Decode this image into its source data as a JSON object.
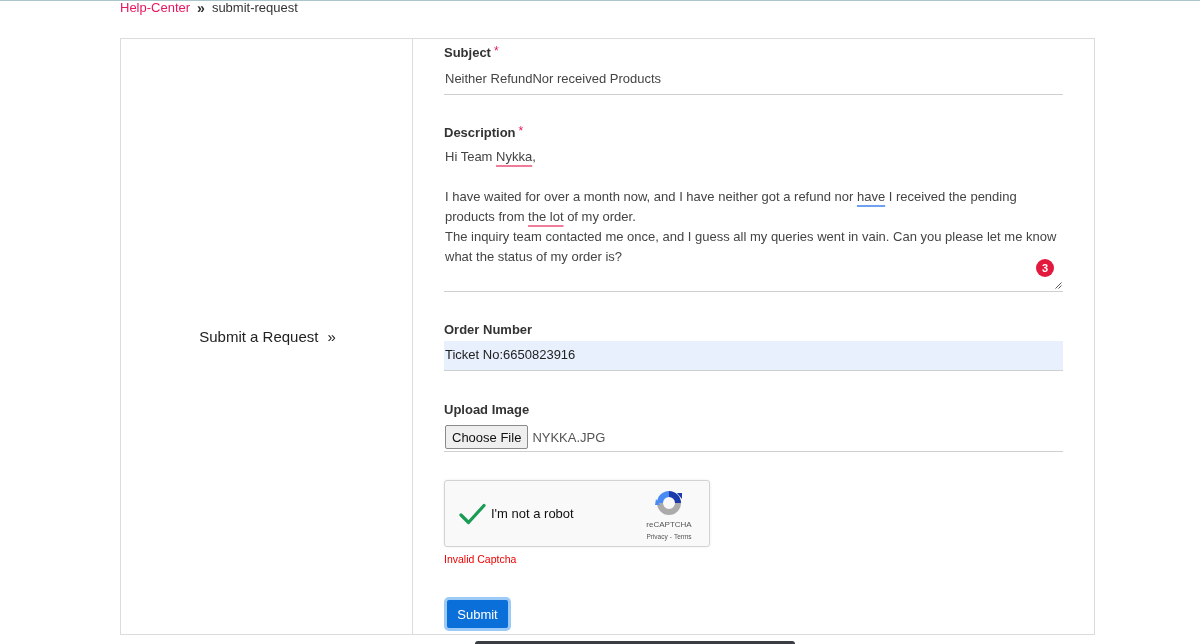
{
  "breadcrumb": {
    "separator": "»",
    "items": [
      {
        "kind": "link",
        "label": "Help-Center"
      },
      {
        "kind": "current",
        "label": "submit-request"
      }
    ]
  },
  "sidebar": {
    "title": "Submit a Request",
    "arrow": "»"
  },
  "form": {
    "required_marker": "*",
    "fields": [
      {
        "kind": "text",
        "label": "Subject",
        "required": true,
        "value": "Neither RefundNor received Products",
        "autofilled": false
      },
      {
        "kind": "textarea",
        "label": "Description",
        "required": true,
        "issue_count": "3",
        "parts": [
          {
            "kind": "plain",
            "text": "Hi Team "
          },
          {
            "kind": "spelling",
            "text": "Nykka"
          },
          {
            "kind": "plain",
            "text": ",\n\nI have waited for over a month now, and I have neither got a refund nor "
          },
          {
            "kind": "grammar",
            "text": "have"
          },
          {
            "kind": "plain",
            "text": " I received the pending products from "
          },
          {
            "kind": "spelling",
            "text": "the lot"
          },
          {
            "kind": "plain",
            "text": " of my order.\nThe inquiry team contacted me once, and I guess all my queries went in vain. Can you please let me know what the status of my order is?"
          }
        ]
      },
      {
        "kind": "text",
        "label": "Order Number",
        "required": false,
        "value": "Ticket No:6650823916",
        "autofilled": true
      },
      {
        "kind": "file",
        "label": "Upload Image",
        "required": false,
        "button": "Choose File",
        "file_name": "NYKKA.JPG"
      }
    ],
    "captcha": {
      "checked": true,
      "label": "I'm not a robot",
      "brand": "reCAPTCHA",
      "links": [
        {
          "label": "Privacy"
        },
        {
          "label": "Terms"
        }
      ],
      "link_separator": "-",
      "error": "Invalid Captcha"
    },
    "submit": {
      "label": "Submit",
      "focused": true
    }
  }
}
